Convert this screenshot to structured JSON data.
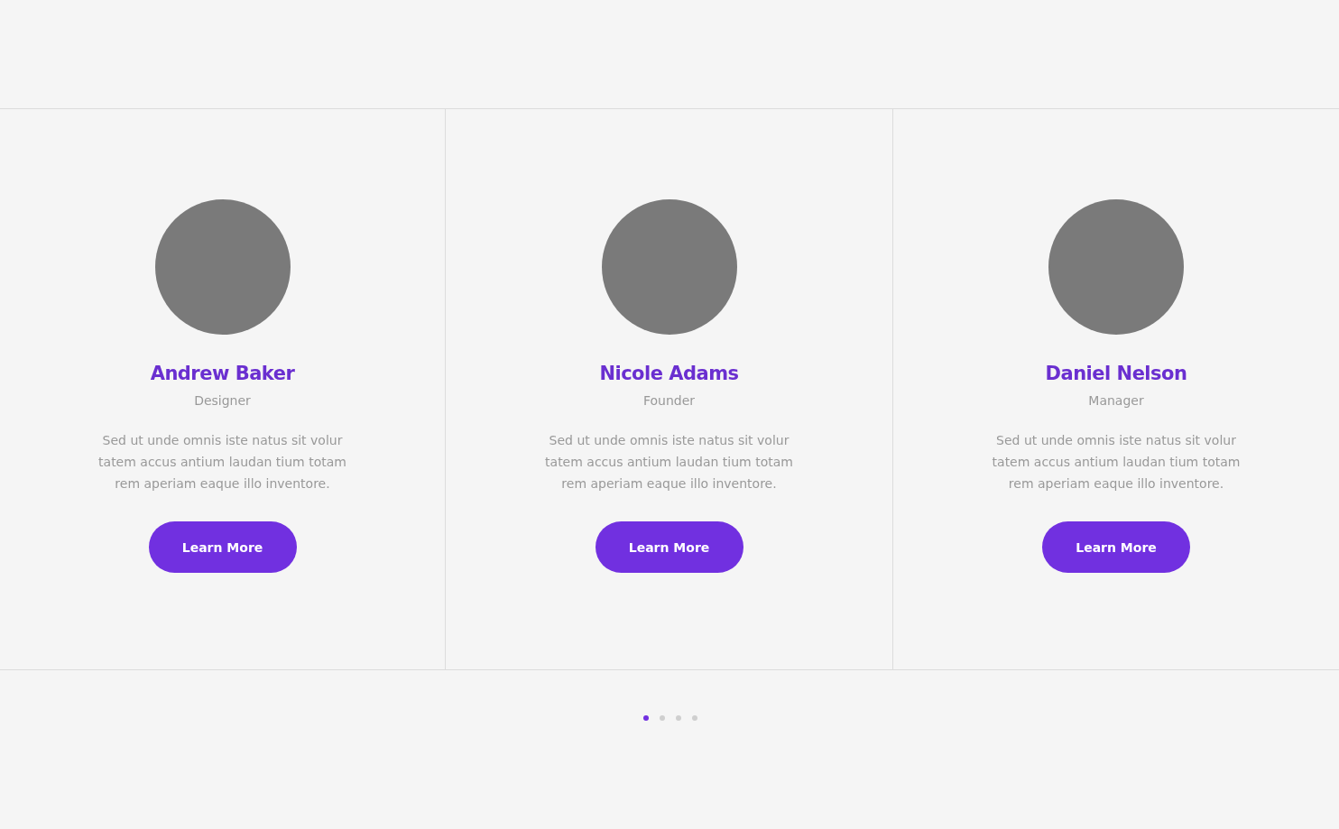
{
  "team": [
    {
      "name": "Andrew Baker",
      "role": "Designer",
      "bio": "Sed ut unde omnis iste natus sit volur tatem accus antium laudan tium totam rem aperiam eaque illo inventore.",
      "button": "Learn More"
    },
    {
      "name": "Nicole Adams",
      "role": "Founder",
      "bio": "Sed ut unde omnis iste natus sit volur tatem accus antium laudan tium totam rem aperiam eaque illo inventore.",
      "button": "Learn More"
    },
    {
      "name": "Daniel Nelson",
      "role": "Manager",
      "bio": "Sed ut unde omnis iste natus sit volur tatem accus antium laudan tium totam rem aperiam eaque illo inventore.",
      "button": "Learn More"
    }
  ],
  "pagination": [
    {
      "selected": true
    },
    {
      "selected": false
    },
    {
      "selected": false
    },
    {
      "selected": false
    }
  ]
}
